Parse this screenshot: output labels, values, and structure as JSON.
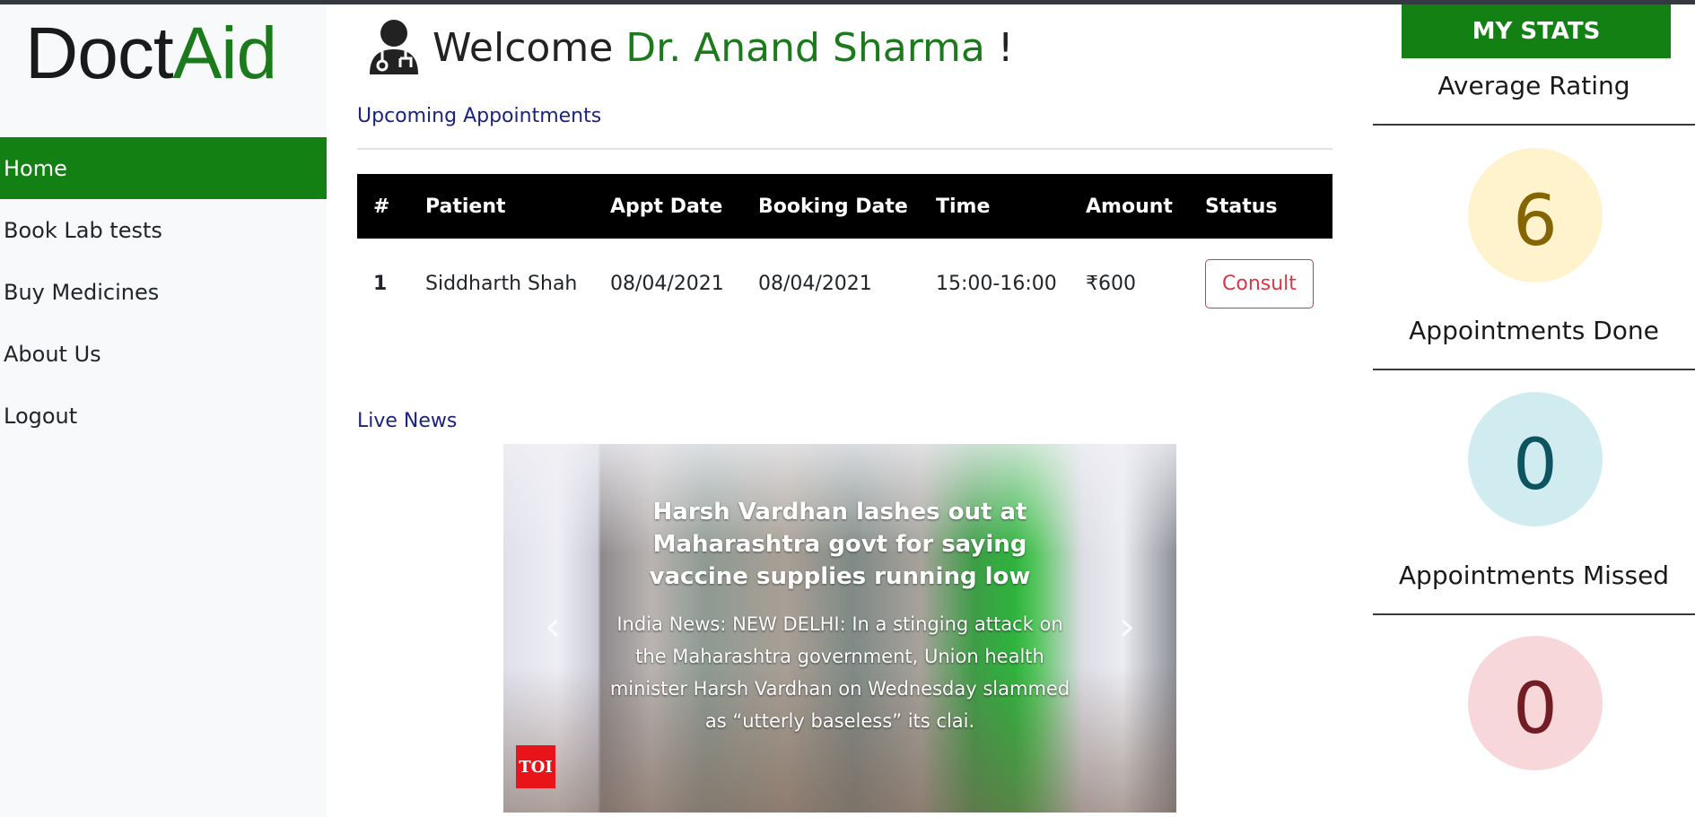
{
  "brand": {
    "part1": "Doct",
    "part2": "Aid"
  },
  "nav": {
    "items": [
      {
        "label": "Home",
        "active": true
      },
      {
        "label": "Book Lab tests",
        "active": false
      },
      {
        "label": "Buy Medicines",
        "active": false
      },
      {
        "label": "About Us",
        "active": false
      },
      {
        "label": "Logout",
        "active": false
      }
    ]
  },
  "header": {
    "icon": "doctor-icon",
    "welcome": "Welcome",
    "doctor_name": "Dr. Anand Sharma",
    "exclamation": "!"
  },
  "appointments": {
    "section_title": "Upcoming Appointments",
    "columns": [
      "#",
      "Patient",
      "Appt Date",
      "Booking Date",
      "Time",
      "Amount",
      "Status"
    ],
    "rows": [
      {
        "index": "1",
        "patient": "Siddharth Shah",
        "appt_date": "08/04/2021",
        "booking_date": "08/04/2021",
        "time": "15:00-16:00",
        "amount": "₹600",
        "status_button": "Consult"
      }
    ]
  },
  "news": {
    "section_title": "Live News",
    "title": "Harsh Vardhan lashes out at Maharashtra govt for saying vaccine supplies running low",
    "text": "India News: NEW DELHI: In a stinging attack on the Maharashtra government, Union health minister Harsh Vardhan on Wednesday slammed as “utterly baseless” its clai.",
    "source_badge": "TOI",
    "prev_icon": "chevron-left-icon",
    "next_icon": "chevron-right-icon"
  },
  "stats": {
    "header": "MY STATS",
    "items": [
      {
        "label": "Average Rating",
        "value": "6",
        "bg": "#fff3cd",
        "fg": "#856404"
      },
      {
        "label": "Appointments Done",
        "value": "0",
        "bg": "#d1ecf1",
        "fg": "#0c5460"
      },
      {
        "label": "Appointments Missed",
        "value": "0",
        "bg": "#f8d7da",
        "fg": "#721c24"
      }
    ]
  },
  "colors": {
    "brand_green": "#138013",
    "link_blue": "#1a237e",
    "danger": "#dc3545"
  }
}
